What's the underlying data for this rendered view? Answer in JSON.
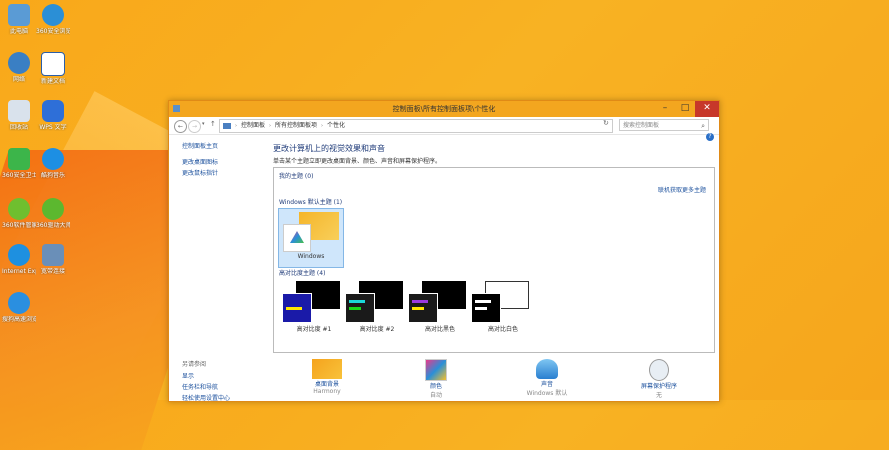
{
  "desktop": {
    "icons": [
      {
        "label": "此电脑",
        "icon": "computer-icon"
      },
      {
        "label": "360安全浏览器",
        "icon": "browser-icon"
      },
      {
        "label": "网络",
        "icon": "network-icon"
      },
      {
        "label": "新建文档",
        "icon": "document-icon"
      },
      {
        "label": "回收站",
        "icon": "recycle-bin-icon"
      },
      {
        "label": "WPS 文字",
        "icon": "wps-icon"
      },
      {
        "label": "360安全卫士",
        "icon": "shield-icon"
      },
      {
        "label": "酷狗音乐",
        "icon": "music-icon"
      },
      {
        "label": "360软件管家",
        "icon": "software-icon"
      },
      {
        "label": "360驱动大师",
        "icon": "driver-icon"
      },
      {
        "label": "Internet Explorer",
        "icon": "ie-icon"
      },
      {
        "label": "宽带连接",
        "icon": "broadband-icon"
      },
      {
        "label": "搜狗高速浏览器",
        "icon": "sogou-icon"
      }
    ]
  },
  "window": {
    "title": "控制面板\\所有控制面板项\\个性化",
    "breadcrumb": [
      "控制面板",
      "所有控制面板项",
      "个性化"
    ],
    "search_placeholder": "搜索控制面板",
    "left_pane": {
      "home": "控制面板主页",
      "change_desktop_icons": "更改桌面图标",
      "change_mouse_pointers": "更改鼠标指针",
      "see_also": "另请参阅",
      "display": "显示",
      "taskbar": "任务栏和导航",
      "ease_of_access": "轻松使用设置中心"
    },
    "main": {
      "heading": "更改计算机上的视觉效果和声音",
      "description": "单击某个主题立即更改桌面背景、颜色、声音和屏幕保护程序。",
      "my_themes": "我的主题 (0)",
      "get_more": "联机获取更多主题",
      "windows_default": "Windows 默认主题 (1)",
      "windows_theme_label": "Windows",
      "high_contrast": "高对比度主题 (4)",
      "hc_themes": [
        {
          "label": "高对比度 #1"
        },
        {
          "label": "高对比度 #2"
        },
        {
          "label": "高对比黑色"
        },
        {
          "label": "高对比白色"
        }
      ],
      "bottom": [
        {
          "label": "桌面背景",
          "sub": "Harmony"
        },
        {
          "label": "颜色",
          "sub": "自动"
        },
        {
          "label": "声音",
          "sub": "Windows 默认"
        },
        {
          "label": "屏幕保护程序",
          "sub": "无"
        }
      ]
    }
  },
  "colors": {
    "accent": "#f3a61f",
    "link": "#1a4f9c"
  }
}
